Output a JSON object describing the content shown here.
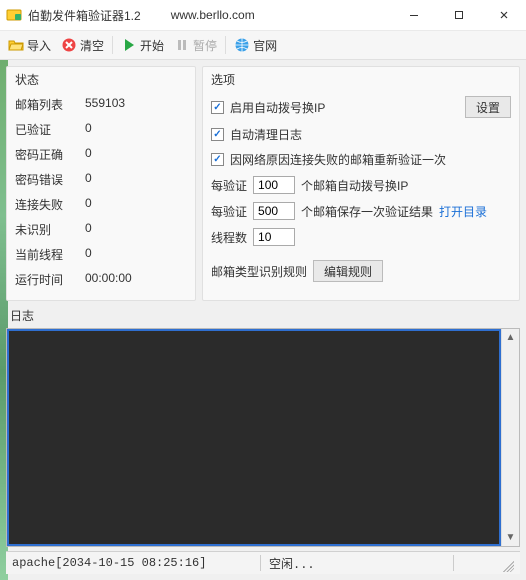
{
  "window": {
    "title": "伯勤发件箱验证器1.2",
    "url": "www.berllo.com"
  },
  "toolbar": {
    "import": "导入",
    "clear": "清空",
    "start": "开始",
    "pause": "暂停",
    "official": "官网"
  },
  "status": {
    "panel_title": "状态",
    "rows": [
      {
        "k": "邮箱列表",
        "v": "559103"
      },
      {
        "k": "已验证",
        "v": "0"
      },
      {
        "k": "密码正确",
        "v": "0"
      },
      {
        "k": "密码错误",
        "v": "0"
      },
      {
        "k": "连接失败",
        "v": "0"
      },
      {
        "k": "未识别",
        "v": "0"
      },
      {
        "k": "当前线程",
        "v": "0"
      },
      {
        "k": "运行时间",
        "v": "00:00:00"
      }
    ]
  },
  "options": {
    "panel_title": "选项",
    "chk_auto_dial": "启用自动拨号换IP",
    "btn_settings": "设置",
    "chk_auto_clean_log": "自动清理日志",
    "chk_retry_net_fail": "因网络原因连接失败的邮箱重新验证一次",
    "per_verify_label": "每验证",
    "dial_count": "100",
    "dial_suffix": "个邮箱自动拨号换IP",
    "save_count": "500",
    "save_suffix": "个邮箱保存一次验证结果",
    "open_dir": "打开目录",
    "thread_label": "线程数",
    "thread_count": "10",
    "rule_label": "邮箱类型识别规则",
    "btn_edit_rule": "编辑规则"
  },
  "log": {
    "label": "日志",
    "content": ""
  },
  "statusbar": {
    "left": "apache[2034-10-15 08:25:16]",
    "mid": "空闲..."
  }
}
